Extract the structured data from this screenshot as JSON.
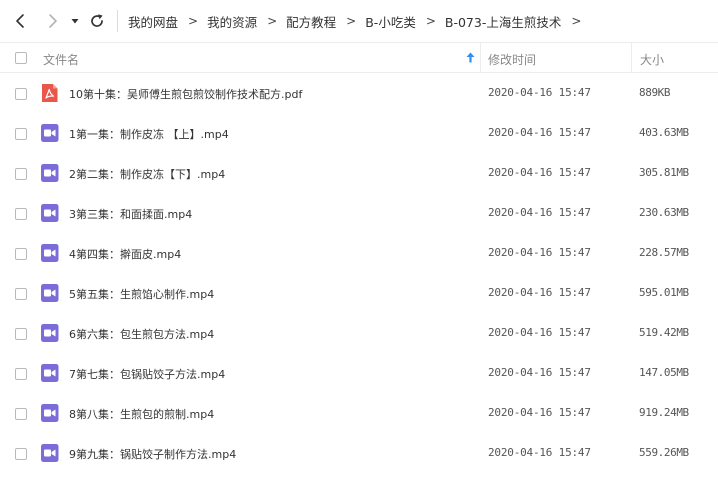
{
  "navigation": {
    "back_icon": "chevron-left-icon",
    "forward_icon": "chevron-right-icon",
    "history_icon": "caret-down-icon",
    "refresh_icon": "refresh-icon"
  },
  "breadcrumb": {
    "items": [
      "我的网盘",
      "我的资源",
      "配方教程",
      "B-小吃类",
      "B-073-上海生煎技术"
    ],
    "separator": ">"
  },
  "header": {
    "name": "文件名",
    "modified": "修改时间",
    "size": "大小",
    "sort_icon": "arrow-up-icon"
  },
  "colors": {
    "pdf_icon": "#e9564a",
    "video_icon": "#7b6cd9",
    "sort_arrow": "#2f8ff2"
  },
  "files": [
    {
      "name": "10第十集：吴师傅生煎包煎饺制作技术配方.pdf",
      "modified": "2020-04-16 15:47",
      "size": "889KB",
      "type": "pdf"
    },
    {
      "name": "1第一集：制作皮冻 【上】.mp4",
      "modified": "2020-04-16 15:47",
      "size": "403.63MB",
      "type": "video"
    },
    {
      "name": "2第二集：制作皮冻【下】.mp4",
      "modified": "2020-04-16 15:47",
      "size": "305.81MB",
      "type": "video"
    },
    {
      "name": "3第三集：和面揉面.mp4",
      "modified": "2020-04-16 15:47",
      "size": "230.63MB",
      "type": "video"
    },
    {
      "name": "4第四集：擀面皮.mp4",
      "modified": "2020-04-16 15:47",
      "size": "228.57MB",
      "type": "video"
    },
    {
      "name": "5第五集：生煎馅心制作.mp4",
      "modified": "2020-04-16 15:47",
      "size": "595.01MB",
      "type": "video"
    },
    {
      "name": "6第六集：包生煎包方法.mp4",
      "modified": "2020-04-16 15:47",
      "size": "519.42MB",
      "type": "video"
    },
    {
      "name": "7第七集：包锅贴饺子方法.mp4",
      "modified": "2020-04-16 15:47",
      "size": "147.05MB",
      "type": "video"
    },
    {
      "name": "8第八集：生煎包的煎制.mp4",
      "modified": "2020-04-16 15:47",
      "size": "919.24MB",
      "type": "video"
    },
    {
      "name": "9第九集：锅贴饺子制作方法.mp4",
      "modified": "2020-04-16 15:47",
      "size": "559.26MB",
      "type": "video"
    }
  ]
}
